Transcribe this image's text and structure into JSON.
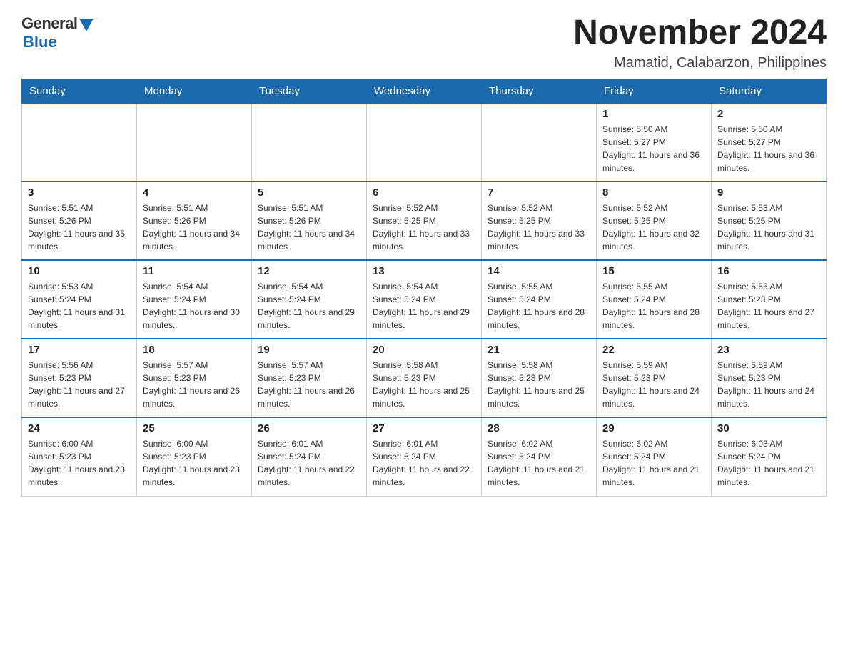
{
  "logo": {
    "general": "General",
    "blue": "Blue"
  },
  "title": "November 2024",
  "subtitle": "Mamatid, Calabarzon, Philippines",
  "days_of_week": [
    "Sunday",
    "Monday",
    "Tuesday",
    "Wednesday",
    "Thursday",
    "Friday",
    "Saturday"
  ],
  "weeks": [
    [
      {
        "day": "",
        "info": ""
      },
      {
        "day": "",
        "info": ""
      },
      {
        "day": "",
        "info": ""
      },
      {
        "day": "",
        "info": ""
      },
      {
        "day": "",
        "info": ""
      },
      {
        "day": "1",
        "info": "Sunrise: 5:50 AM\nSunset: 5:27 PM\nDaylight: 11 hours and 36 minutes."
      },
      {
        "day": "2",
        "info": "Sunrise: 5:50 AM\nSunset: 5:27 PM\nDaylight: 11 hours and 36 minutes."
      }
    ],
    [
      {
        "day": "3",
        "info": "Sunrise: 5:51 AM\nSunset: 5:26 PM\nDaylight: 11 hours and 35 minutes."
      },
      {
        "day": "4",
        "info": "Sunrise: 5:51 AM\nSunset: 5:26 PM\nDaylight: 11 hours and 34 minutes."
      },
      {
        "day": "5",
        "info": "Sunrise: 5:51 AM\nSunset: 5:26 PM\nDaylight: 11 hours and 34 minutes."
      },
      {
        "day": "6",
        "info": "Sunrise: 5:52 AM\nSunset: 5:25 PM\nDaylight: 11 hours and 33 minutes."
      },
      {
        "day": "7",
        "info": "Sunrise: 5:52 AM\nSunset: 5:25 PM\nDaylight: 11 hours and 33 minutes."
      },
      {
        "day": "8",
        "info": "Sunrise: 5:52 AM\nSunset: 5:25 PM\nDaylight: 11 hours and 32 minutes."
      },
      {
        "day": "9",
        "info": "Sunrise: 5:53 AM\nSunset: 5:25 PM\nDaylight: 11 hours and 31 minutes."
      }
    ],
    [
      {
        "day": "10",
        "info": "Sunrise: 5:53 AM\nSunset: 5:24 PM\nDaylight: 11 hours and 31 minutes."
      },
      {
        "day": "11",
        "info": "Sunrise: 5:54 AM\nSunset: 5:24 PM\nDaylight: 11 hours and 30 minutes."
      },
      {
        "day": "12",
        "info": "Sunrise: 5:54 AM\nSunset: 5:24 PM\nDaylight: 11 hours and 29 minutes."
      },
      {
        "day": "13",
        "info": "Sunrise: 5:54 AM\nSunset: 5:24 PM\nDaylight: 11 hours and 29 minutes."
      },
      {
        "day": "14",
        "info": "Sunrise: 5:55 AM\nSunset: 5:24 PM\nDaylight: 11 hours and 28 minutes."
      },
      {
        "day": "15",
        "info": "Sunrise: 5:55 AM\nSunset: 5:24 PM\nDaylight: 11 hours and 28 minutes."
      },
      {
        "day": "16",
        "info": "Sunrise: 5:56 AM\nSunset: 5:23 PM\nDaylight: 11 hours and 27 minutes."
      }
    ],
    [
      {
        "day": "17",
        "info": "Sunrise: 5:56 AM\nSunset: 5:23 PM\nDaylight: 11 hours and 27 minutes."
      },
      {
        "day": "18",
        "info": "Sunrise: 5:57 AM\nSunset: 5:23 PM\nDaylight: 11 hours and 26 minutes."
      },
      {
        "day": "19",
        "info": "Sunrise: 5:57 AM\nSunset: 5:23 PM\nDaylight: 11 hours and 26 minutes."
      },
      {
        "day": "20",
        "info": "Sunrise: 5:58 AM\nSunset: 5:23 PM\nDaylight: 11 hours and 25 minutes."
      },
      {
        "day": "21",
        "info": "Sunrise: 5:58 AM\nSunset: 5:23 PM\nDaylight: 11 hours and 25 minutes."
      },
      {
        "day": "22",
        "info": "Sunrise: 5:59 AM\nSunset: 5:23 PM\nDaylight: 11 hours and 24 minutes."
      },
      {
        "day": "23",
        "info": "Sunrise: 5:59 AM\nSunset: 5:23 PM\nDaylight: 11 hours and 24 minutes."
      }
    ],
    [
      {
        "day": "24",
        "info": "Sunrise: 6:00 AM\nSunset: 5:23 PM\nDaylight: 11 hours and 23 minutes."
      },
      {
        "day": "25",
        "info": "Sunrise: 6:00 AM\nSunset: 5:23 PM\nDaylight: 11 hours and 23 minutes."
      },
      {
        "day": "26",
        "info": "Sunrise: 6:01 AM\nSunset: 5:24 PM\nDaylight: 11 hours and 22 minutes."
      },
      {
        "day": "27",
        "info": "Sunrise: 6:01 AM\nSunset: 5:24 PM\nDaylight: 11 hours and 22 minutes."
      },
      {
        "day": "28",
        "info": "Sunrise: 6:02 AM\nSunset: 5:24 PM\nDaylight: 11 hours and 21 minutes."
      },
      {
        "day": "29",
        "info": "Sunrise: 6:02 AM\nSunset: 5:24 PM\nDaylight: 11 hours and 21 minutes."
      },
      {
        "day": "30",
        "info": "Sunrise: 6:03 AM\nSunset: 5:24 PM\nDaylight: 11 hours and 21 minutes."
      }
    ]
  ]
}
